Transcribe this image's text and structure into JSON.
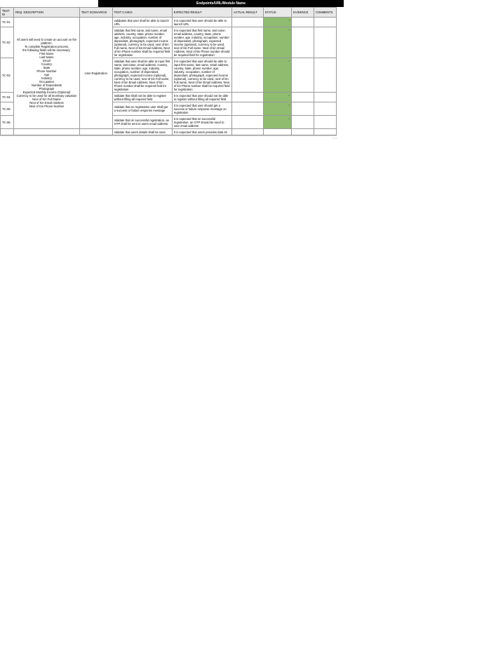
{
  "title_bar": "Endpoints/URL/Module Name",
  "headers": {
    "tc": "TEST ID",
    "req": "REQ. DESCRIPTION",
    "scen": "TEST SCENARIOS",
    "cases": "TEST CASES",
    "exp": "EXPECTED RESULT",
    "act": "ACTUAL RESULT",
    "status": "STATUS",
    "ev": "EVIDENCE",
    "com": "COMMENTS"
  },
  "req_description": "All users  will need to create an account on the platform.\nTo complete Registration process,\nthe following fields will be necessary:\nFirst Name\nLast Name\nEmail\nCountry\nState\nPhone Number\nAge\nIndustry\nOccupation\nNumber of Dependants\nPhotograph\nExpected Monthly Income (Optional)\nCurrency to be used for all monetary valuation\nNext of Kin Full Name\nNext of Kin Email Address\nNext of Kin Phone Number",
  "test_scenario": "User Registration",
  "rows": [
    {
      "id": "TC-01",
      "case": "validatete that user shall be able to launch URL",
      "exp": "It is expected that user should be able to launch URL"
    },
    {
      "id": "TC-02",
      "case": "Validate  that first name, last name, email address, country, state, phone number, age, industry, occupation, number of dependant, photograph, expected income (optional), currency to be used, next of kin Full name, Next of kin Email Address, Next of kin Phone number shall be  required  field for registration",
      "exp": "It is expected  that first name, last name, email address, country, state, phone number, age, industry, occupation, number of dependant, photograph, expected income (optional), currency to be used, next of kin Full name, Next of kin Email Address, Next of kin Phone number should be required  field for registration"
    },
    {
      "id": "TC-03",
      "case": "Validate  that user shall be able to input  first name, last name, email address, country, state, phone number, age, industry, occupation, number of dependant, photograph, expected income (optional), currency to be used, next of kin Full name, Next of kin Email Address, Next of kin Phone number shall be  required  field for registration",
      "exp": "It is expected that user  should be able to input  first name, last name, email address, country, state, phone number, age, industry, occupation, number of dependant, photograph, expected income (optional), currency to be used, next of kin Full name, Next of kin Email Address, Next of kin Phone number shall be  required  field for registration"
    },
    {
      "id": "TC-04",
      "case": "Validate that shall not be able to register without filling all required field",
      "exp": "It is expected that user should not be able to register without filling all required field"
    },
    {
      "id": "TC-05",
      "case": "Validate that on registration user shall get a success or failure response message",
      "exp": "It is expected that  user should get a success or failure response message on registration"
    },
    {
      "id": "TC-06",
      "case": "Validate that on successful registration, an OTP shall be sent to users email address",
      "exp": "It is expected that on successful registration, an OTP should be send to user email address"
    }
  ],
  "partial_row": {
    "case": "Validate that users details shall be save",
    "exp": "It is expected that users provides data sh"
  },
  "marker": "*",
  "footer": "1 / 2"
}
